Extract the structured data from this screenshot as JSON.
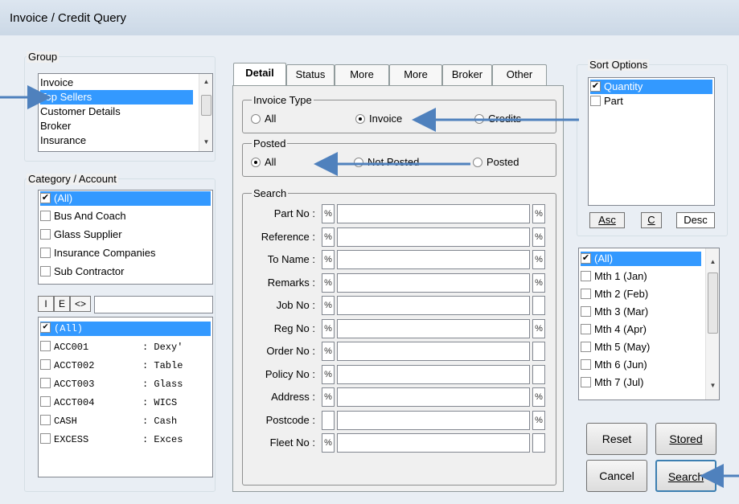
{
  "window": {
    "title": "Invoice / Credit Query"
  },
  "group": {
    "legend": "Group",
    "items": [
      "Invoice",
      "Top Sellers",
      "Customer Details",
      "Broker",
      "Insurance"
    ],
    "selected_index": 1
  },
  "category": {
    "legend": "Category / Account",
    "items": [
      "(All)",
      "Bus And Coach",
      "Glass Supplier",
      "Insurance Companies",
      "Sub Contractor"
    ],
    "checked_index": 0
  },
  "account_filter": {
    "toggles": [
      "I",
      "E",
      "<>"
    ],
    "text": ""
  },
  "accounts": [
    {
      "code": "(All)",
      "name": ""
    },
    {
      "code": "ACC001",
      "name": ": Dexy'"
    },
    {
      "code": "ACCT002",
      "name": ": Table"
    },
    {
      "code": "ACCT003",
      "name": ": Glass"
    },
    {
      "code": "ACCT004",
      "name": ": WICS"
    },
    {
      "code": "CASH",
      "name": ": Cash"
    },
    {
      "code": "EXCESS",
      "name": ": Exces"
    }
  ],
  "tabs": [
    "Detail",
    "Status",
    "More",
    "More",
    "Broker",
    "Other"
  ],
  "invoice_type": {
    "legend": "Invoice Type",
    "options": [
      "All",
      "Invoice",
      "Credits"
    ],
    "selected": "Invoice"
  },
  "posted": {
    "legend": "Posted",
    "options": [
      "All",
      "Not Posted",
      "Posted"
    ],
    "selected": "All"
  },
  "search": {
    "legend": "Search",
    "fields": [
      {
        "label": "Part No :",
        "left": "%",
        "value": "",
        "right": "%"
      },
      {
        "label": "Reference :",
        "left": "%",
        "value": "",
        "right": "%"
      },
      {
        "label": "To Name :",
        "left": "%",
        "value": "",
        "right": "%"
      },
      {
        "label": "Remarks :",
        "left": "%",
        "value": "",
        "right": "%"
      },
      {
        "label": "Job No :",
        "left": "%",
        "value": "",
        "right": ""
      },
      {
        "label": "Reg No :",
        "left": "%",
        "value": "",
        "right": "%"
      },
      {
        "label": "Order No :",
        "left": "%",
        "value": "",
        "right": ""
      },
      {
        "label": "Policy No :",
        "left": "%",
        "value": "",
        "right": ""
      },
      {
        "label": "Address :",
        "left": "%",
        "value": "",
        "right": "%"
      },
      {
        "label": "Postcode :",
        "left": "",
        "value": "",
        "right": "%"
      },
      {
        "label": "Fleet No :",
        "left": "%",
        "value": "",
        "right": ""
      }
    ]
  },
  "sort_options": {
    "legend": "Sort Options",
    "items": [
      {
        "label": "Quantity",
        "checked": true
      },
      {
        "label": "Part",
        "checked": false
      }
    ],
    "buttons": [
      "Asc",
      "C",
      "Desc"
    ]
  },
  "months": [
    {
      "label": "(All)",
      "checked": true
    },
    {
      "label": "Mth 1 (Jan)",
      "checked": false
    },
    {
      "label": "Mth 2 (Feb)",
      "checked": false
    },
    {
      "label": "Mth 3 (Mar)",
      "checked": false
    },
    {
      "label": "Mth 4 (Apr)",
      "checked": false
    },
    {
      "label": "Mth 5 (May)",
      "checked": false
    },
    {
      "label": "Mth 6 (Jun)",
      "checked": false
    },
    {
      "label": "Mth 7 (Jul)",
      "checked": false
    }
  ],
  "buttons": {
    "reset": "Reset",
    "stored": "Stored",
    "cancel": "Cancel",
    "search": "Search"
  },
  "colors": {
    "selection": "#3399ff",
    "annotation_arrow": "#4f81bd"
  }
}
